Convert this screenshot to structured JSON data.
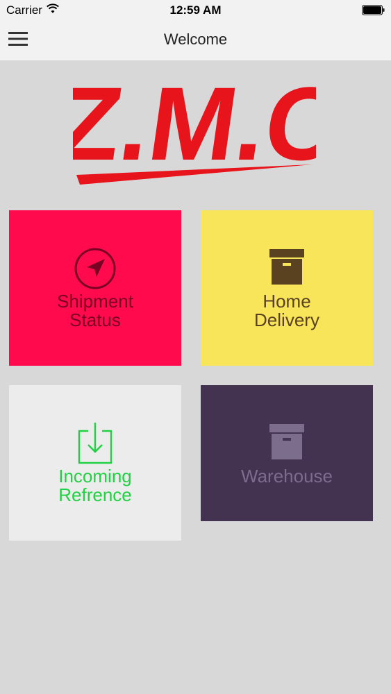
{
  "status_bar": {
    "carrier": "Carrier",
    "time": "12:59 AM",
    "wifi_icon": "wifi-icon",
    "battery_icon": "battery-icon"
  },
  "nav": {
    "title": "Welcome",
    "menu_icon": "hamburger-menu-icon"
  },
  "logo": {
    "text": "Z.M.C",
    "color": "#e8141b"
  },
  "tiles": [
    {
      "label": "Shipment\nStatus",
      "icon": "navigation-arrow-icon",
      "bg": "#fe0a4d",
      "fg": "#7a0024"
    },
    {
      "label": "Home\nDelivery",
      "icon": "archive-box-icon",
      "bg": "#f8e55a",
      "fg": "#5a4120"
    },
    {
      "label": "Incoming\nRefrence",
      "icon": "download-tray-icon",
      "bg": "#ececec",
      "fg": "#22d143"
    },
    {
      "label": "Warehouse",
      "icon": "archive-box-icon",
      "bg": "#433351",
      "fg": "#7c6d8c"
    }
  ]
}
